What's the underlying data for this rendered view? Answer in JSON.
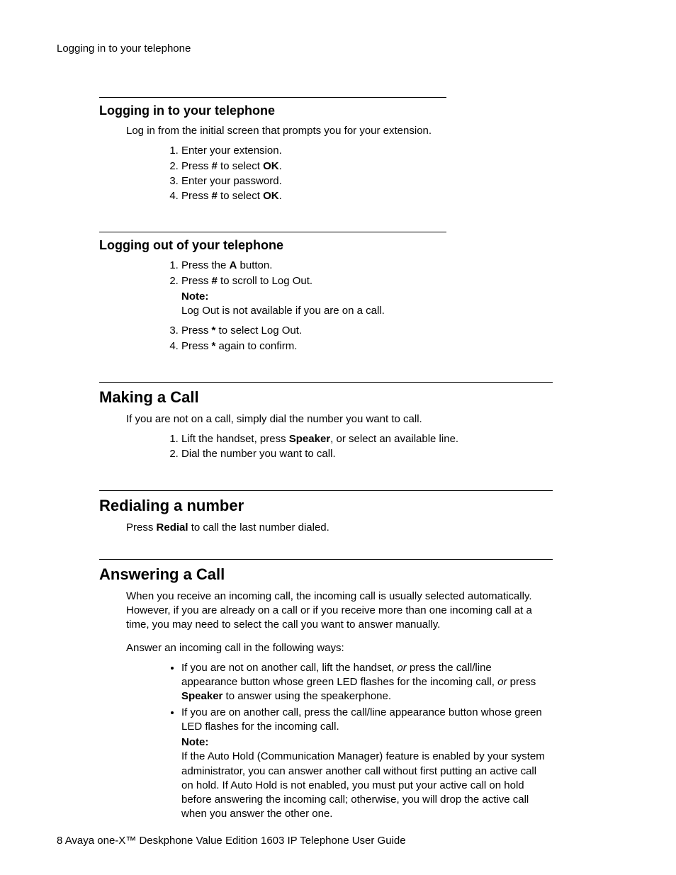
{
  "running_head": "Logging in to your telephone",
  "s1": {
    "title": "Logging in to your telephone",
    "intro": "Log in from the initial screen that prompts you for your extension.",
    "steps": {
      "1": "Enter your extension.",
      "2a": "Press ",
      "2b": "#",
      "2c": " to select ",
      "2d": "OK",
      "2e": ".",
      "3": "Enter your password.",
      "4a": "Press ",
      "4b": "#",
      "4c": " to select ",
      "4d": "OK",
      "4e": "."
    }
  },
  "s2": {
    "title": "Logging out of your telephone",
    "steps": {
      "1a": "Press the ",
      "1b": "A",
      "1c": " button.",
      "2a": "Press ",
      "2b": "#",
      "2c": " to scroll to Log Out.",
      "note_label": "Note:",
      "note_text": "Log Out is not available if you are on a call.",
      "3a": "Press ",
      "3b": "*",
      "3c": " to select Log Out.",
      "4a": "Press ",
      "4b": "*",
      "4c": " again to confirm."
    }
  },
  "s3": {
    "title": "Making a Call",
    "intro": "If you are not on a call, simply dial the number you want to call.",
    "steps": {
      "1a": "Lift the handset, press ",
      "1b": "Speaker",
      "1c": ", or select an available line.",
      "2": "Dial the number you want to call."
    }
  },
  "s4": {
    "title": "Redialing a number",
    "p1a": "Press ",
    "p1b": "Redial",
    "p1c": " to call the last number dialed."
  },
  "s5": {
    "title": "Answering a Call",
    "p1": "When you receive an incoming call, the incoming call is usually selected automatically. However, if you are already on a call or if you receive more than one incoming call at a time, you may need to select the call you want to answer manually.",
    "p2": "Answer an incoming call in the following ways:",
    "b1a": "If you are not on another call, lift the handset, ",
    "b1b": "or",
    "b1c": " press the call/line appearance button whose green LED flashes for the incoming call, ",
    "b1d": "or",
    "b1e": " press ",
    "b1f": "Speaker",
    "b1g": " to answer using the speakerphone.",
    "b2": "If you are on another call, press the call/line appearance button whose green LED flashes for the incoming call.",
    "note_label": "Note:",
    "note_text": "If the Auto Hold (Communication Manager) feature is enabled by your system administrator, you can answer another call without first putting an active call on hold. If Auto Hold is not enabled, you must put your active call on hold before answering the incoming call; otherwise, you will drop the active call when you answer the other one."
  },
  "footer": {
    "page_num": "8",
    "sep": "   ",
    "title": "Avaya one-X™ Deskphone Value Edition 1603 IP Telephone User Guide"
  }
}
